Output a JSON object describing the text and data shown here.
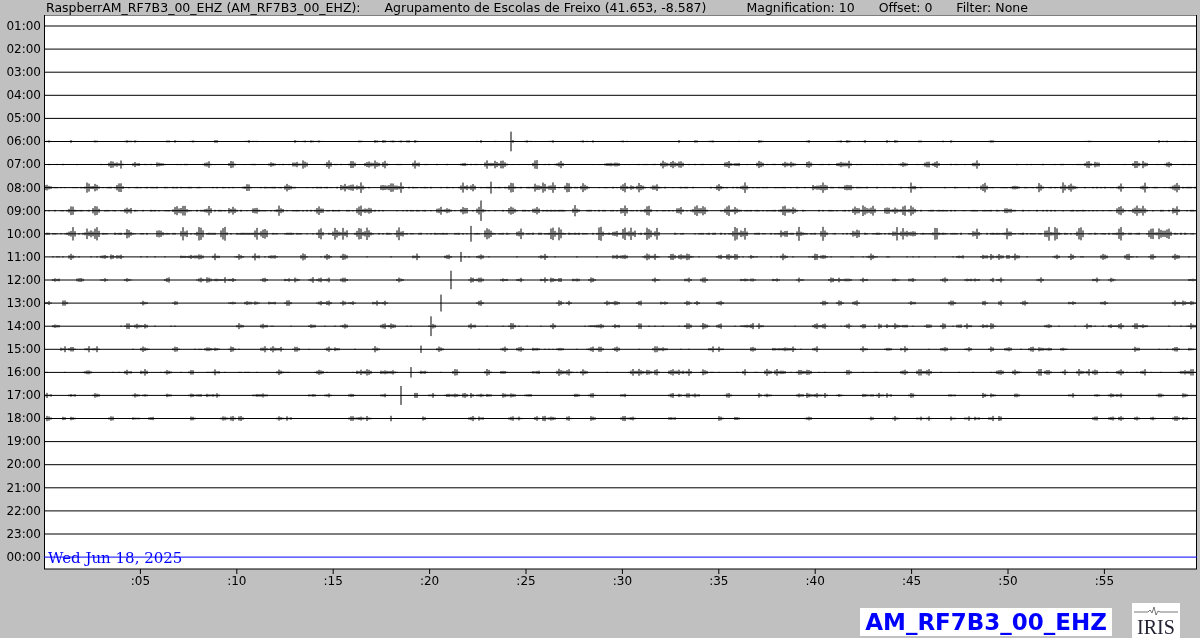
{
  "header": {
    "station": "RaspberrAM_RF7B3_00_EHZ (AM_RF7B3_00_EHZ):",
    "location": "Agrupamento de Escolas de Freixo (41.653, -8.587)",
    "magnification": "Magnification: 10",
    "offset": "Offset: 0",
    "filter": "Filter: None"
  },
  "rows": [
    {
      "label": "01:00"
    },
    {
      "label": "02:00"
    },
    {
      "label": "03:00"
    },
    {
      "label": "04:00"
    },
    {
      "label": "05:00"
    },
    {
      "label": "06:00"
    },
    {
      "label": "07:00"
    },
    {
      "label": "08:00"
    },
    {
      "label": "09:00"
    },
    {
      "label": "10:00"
    },
    {
      "label": "11:00"
    },
    {
      "label": "12:00"
    },
    {
      "label": "13:00"
    },
    {
      "label": "14:00"
    },
    {
      "label": "15:00"
    },
    {
      "label": "16:00"
    },
    {
      "label": "17:00"
    },
    {
      "label": "18:00"
    },
    {
      "label": "19:00"
    },
    {
      "label": "20:00"
    },
    {
      "label": "21:00"
    },
    {
      "label": "22:00"
    },
    {
      "label": "23:00"
    },
    {
      "label": "00:00"
    }
  ],
  "date": "Wed Jun 18, 2025",
  "xticks": [
    ":05",
    ":10",
    ":15",
    ":20",
    ":25",
    ":30",
    ":35",
    ":40",
    ":45",
    ":50",
    ":55"
  ],
  "channel_label": "AM_RF7B3_00_EHZ",
  "logo_text": "IRIS"
}
